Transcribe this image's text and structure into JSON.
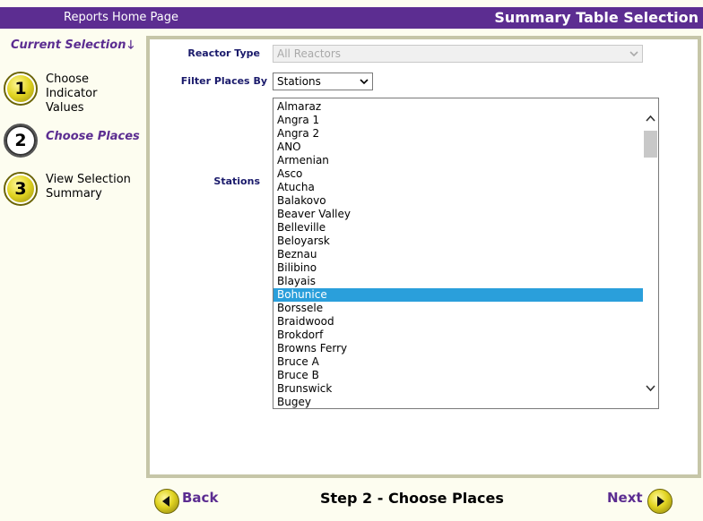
{
  "header": {
    "home_link": "Reports Home Page",
    "title": "Summary Table Selection"
  },
  "sidebar": {
    "current_selection": "Current Selection",
    "steps": [
      {
        "number": "1",
        "label_lines": [
          "Choose",
          "Indicator",
          "Values"
        ],
        "active": false
      },
      {
        "number": "2",
        "label_lines": [
          "Choose Places"
        ],
        "active": true
      },
      {
        "number": "3",
        "label_lines": [
          "View Selection",
          "Summary"
        ],
        "active": false
      }
    ]
  },
  "form": {
    "reactor_type": {
      "label": "Reactor Type",
      "value": "All Reactors",
      "disabled": true
    },
    "filter_places_by": {
      "label": "Filter Places By",
      "value": "Stations"
    },
    "stations": {
      "label": "Stations",
      "items": [
        "Almaraz",
        "Angra 1",
        "Angra 2",
        "ANO",
        "Armenian",
        "Asco",
        "Atucha",
        "Balakovo",
        "Beaver Valley",
        "Belleville",
        "Beloyarsk",
        "Beznau",
        "Bilibino",
        "Blayais",
        "Bohunice",
        "Borssele",
        "Braidwood",
        "Brokdorf",
        "Browns Ferry",
        "Bruce A",
        "Bruce B",
        "Brunswick",
        "Bugey"
      ],
      "selected": "Bohunice"
    }
  },
  "footer": {
    "back_label": "Back",
    "next_label": "Next",
    "step_label": "Step 2 - Choose Places"
  },
  "colors": {
    "brand_purple": "#5c2d91",
    "selection_blue": "#2a9fdb",
    "panel_border": "#c6c6a8",
    "background": "#fdfdf0"
  }
}
